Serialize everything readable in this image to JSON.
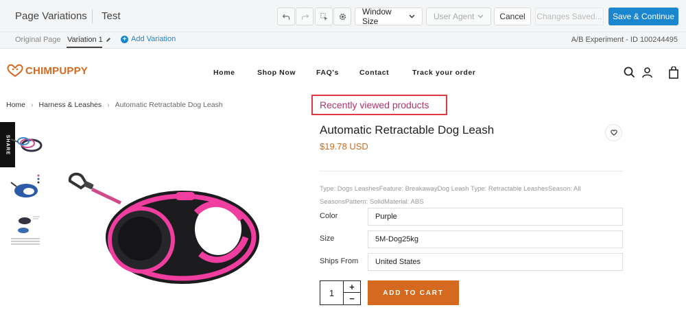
{
  "editor": {
    "title": "Page Variations",
    "experiment_name": "Test",
    "window_size_label": "Window Size",
    "user_agent_label": "User Agent",
    "cancel_label": "Cancel",
    "changes_saved_label": "Changes Saved...",
    "save_continue_label": "Save & Continue",
    "accent_color": "#1a86d0"
  },
  "subbar": {
    "tabs": [
      {
        "label": "Original Page"
      },
      {
        "label": "Variation 1"
      }
    ],
    "add_variation_label": "Add Variation",
    "experiment_id": "A/B Experiment - ID 100244495"
  },
  "site": {
    "logo_text": "CHIMPUPPY",
    "brand_color": "#d4691f",
    "nav": [
      "Home",
      "Shop Now",
      "FAQ's",
      "Contact",
      "Track your order"
    ],
    "breadcrumb": [
      "Home",
      "Harness & Leashes",
      "Automatic Retractable Dog Leash"
    ],
    "share_label": "SHARE"
  },
  "product": {
    "recently_viewed": "Recently viewed products",
    "title": "Automatic Retractable Dog Leash",
    "price": "$19.78 USD",
    "description": "Type: Dogs LeashesFeature: BreakawayDog Leash Type: Retractable LeashesSeason: All SeasonsPattern: SolidMaterial: ABS",
    "options": [
      {
        "label": "Color",
        "value": "Purple"
      },
      {
        "label": "Size",
        "value": "5M-Dog25kg"
      },
      {
        "label": "Ships From",
        "value": "United States"
      }
    ],
    "quantity": "1",
    "qty_plus": "+",
    "qty_minus": "−",
    "add_to_cart": "ADD TO CART"
  }
}
